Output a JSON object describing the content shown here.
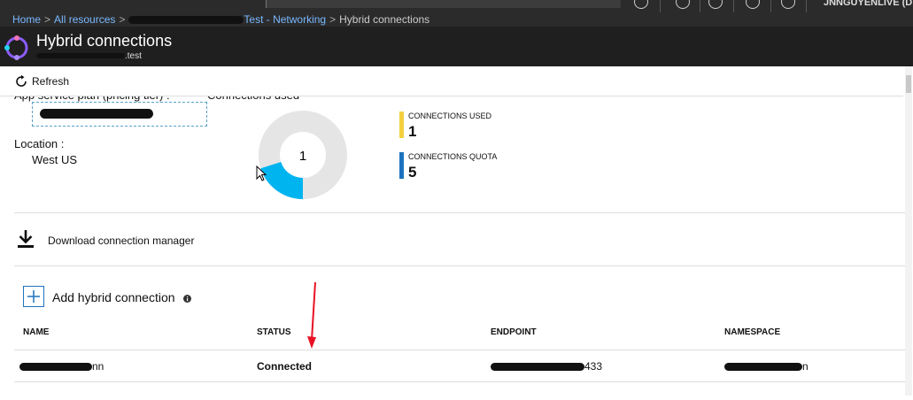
{
  "topbar": {
    "user": "JNNGUYENLIVE (DEFA"
  },
  "breadcrumb": {
    "home": "Home",
    "all_resources": "All resources",
    "middle_suffix": "Test - Networking",
    "current": "Hybrid connections"
  },
  "blade": {
    "title": "Hybrid connections",
    "subtitle_suffix": ".test"
  },
  "toolbar": {
    "refresh": "Refresh"
  },
  "overview": {
    "plan_label": "App service plan (pricing tier) :",
    "connections_used_label": "Connections used",
    "location_label": "Location :",
    "location_value": "West US",
    "donut_center": "1",
    "used": 1,
    "quota": 5
  },
  "legend": [
    {
      "title": "CONNECTIONS USED",
      "value": "1",
      "color": "#f4d03f"
    },
    {
      "title": "CONNECTIONS QUOTA",
      "value": "5",
      "color": "#1e73be"
    }
  ],
  "colors": {
    "donut_used": "#00b4f0",
    "donut_rest": "#e5e5e5"
  },
  "actions": {
    "download": "Download connection manager",
    "add": "Add hybrid connection"
  },
  "table": {
    "headers": [
      "NAME",
      "STATUS",
      "ENDPOINT",
      "NAMESPACE"
    ],
    "rows": [
      {
        "name_suffix": "nn",
        "status": "Connected",
        "endpoint_suffix": "433",
        "namespace_suffix": "n"
      }
    ]
  }
}
